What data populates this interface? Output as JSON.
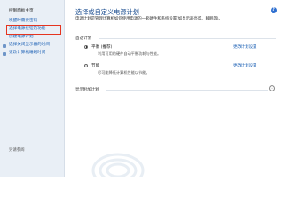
{
  "sidebar": {
    "home": "控制面板主页",
    "links": [
      {
        "label": "唤醒时需要密码",
        "selected": false,
        "icon": false
      },
      {
        "label": "选择电源按钮的功能",
        "selected": true,
        "icon": false
      },
      {
        "label": "创建电源计划",
        "selected": false,
        "icon": false
      },
      {
        "label": "选择关闭显示器的时间",
        "selected": false,
        "icon": true
      },
      {
        "label": "更改计算机睡眠时间",
        "selected": false,
        "icon": true
      }
    ],
    "see_also": "另请参阅"
  },
  "main": {
    "help": "?",
    "title": "选择或自定义电源计划",
    "description": "电源计划是管理计算机如何使用电源的一套硬件和系统设置(如显示器亮度、睡眠等)。",
    "group_label": "首选计划",
    "plans": [
      {
        "name": "平衡 (推荐)",
        "description": "利用可用的硬件自动平衡功耗与性能。",
        "change_link": "更改计划设置",
        "selected": true
      },
      {
        "name": "节能",
        "description": "尽可能降低计算机性能以节能。",
        "change_link": "更改计划设置",
        "selected": false
      }
    ],
    "show_more": "显示附加计划",
    "chevron": "⌄"
  },
  "colors": {
    "accent": "#1d4f91",
    "link": "#1a5fb4",
    "highlight": "#e5341f",
    "sidebar_bg": "#e9eff6"
  }
}
